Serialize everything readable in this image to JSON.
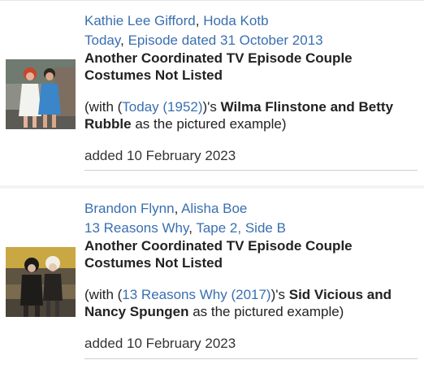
{
  "entries": [
    {
      "people": [
        "Kathie Lee Gifford",
        "Hoda Kotb"
      ],
      "show": "Today",
      "episode": "Episode dated 31 October 2013",
      "title": "Another Coordinated TV Episode Couple Costumes Not Listed",
      "example_prefix": "(with (",
      "example_link": "Today (1952)",
      "example_mid": ")'s ",
      "example_subject": "Wilma Flinstone and Betty Rubble",
      "example_suffix": " as the pictured example)",
      "added": "added 10 February 2023"
    },
    {
      "people": [
        "Brandon Flynn",
        "Alisha Boe"
      ],
      "show": "13 Reasons Why",
      "episode": "Tape 2, Side B",
      "title": "Another Coordinated TV Episode Couple Costumes Not Listed",
      "example_prefix": "(with (",
      "example_link": "13 Reasons Why (2017)",
      "example_mid": ")'s ",
      "example_subject": "Sid Vicious and Nancy Spungen",
      "example_suffix": " as the pictured example)",
      "added": "added 10 February 2023"
    }
  ],
  "separator": ", "
}
